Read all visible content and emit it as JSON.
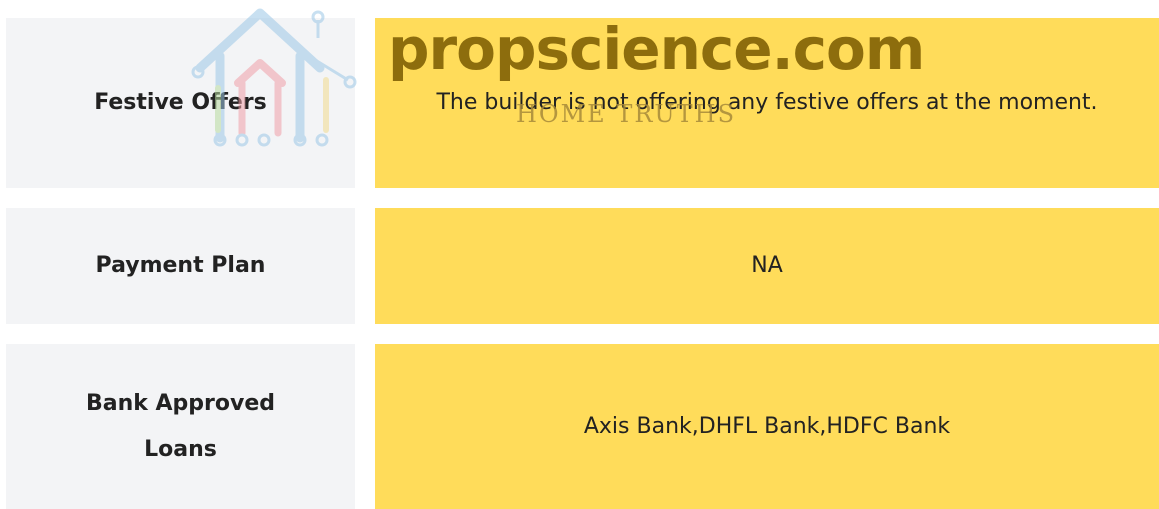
{
  "rows": [
    {
      "label": "Festive Offers",
      "value": "The builder is not offering any festive offers at the moment."
    },
    {
      "label": "Payment Plan",
      "value": "NA"
    },
    {
      "label": "Bank Approved Loans",
      "value": "Axis Bank,DHFL Bank,HDFC Bank"
    }
  ],
  "watermark": {
    "brand": "propscience.com",
    "tagline": "HOME TRUTHS"
  },
  "colors": {
    "label_bg": "#f3f4f6",
    "value_bg": "#ffdc5a",
    "text": "#222222"
  }
}
